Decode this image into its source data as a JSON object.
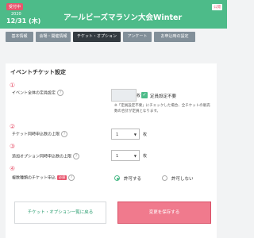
{
  "header": {
    "status_badge": "受付中",
    "year": "2020",
    "date": "12/31 (木)",
    "event_title": "アールビーズマラソン大会Winter",
    "public_badge": "公開"
  },
  "tabs": [
    {
      "label": "基本情報"
    },
    {
      "label": "会場・開催情報"
    },
    {
      "label": "チケット・オプション"
    },
    {
      "label": "アンケート"
    },
    {
      "label": "お申込時の設定"
    }
  ],
  "section": {
    "title": "イベントチケット設定"
  },
  "fields": {
    "capacity": {
      "num": "①",
      "label": "イベント全体の定員設定",
      "unit": "枚",
      "checkbox_label": "定員設定不要",
      "note": "※「定員設定不要」にチェックした場合、全チケットの販売数の合計が定員となります。"
    },
    "ticket_limit": {
      "num": "②",
      "label": "チケット同時申込数の上限",
      "value": "1",
      "unit": "枚"
    },
    "option_limit": {
      "num": "③",
      "label": "追加オプション同時申込数の上限",
      "value": "1",
      "unit": "枚"
    },
    "multi_type": {
      "num": "④",
      "label": "複数種類のチケット申込",
      "required": "必須",
      "option_allow": "許可する",
      "option_deny": "許可しない",
      "selected": "許可する"
    }
  },
  "buttons": {
    "back": "チケット・オプション一覧に戻る",
    "save": "変更を保存する"
  },
  "help_glyph": "?",
  "colors": {
    "brand_green": "#4dbb89",
    "accent_pink": "#e8556d",
    "save_button": "#f07a8d",
    "tab_active": "#333a40",
    "tab_inactive": "#828f99"
  }
}
